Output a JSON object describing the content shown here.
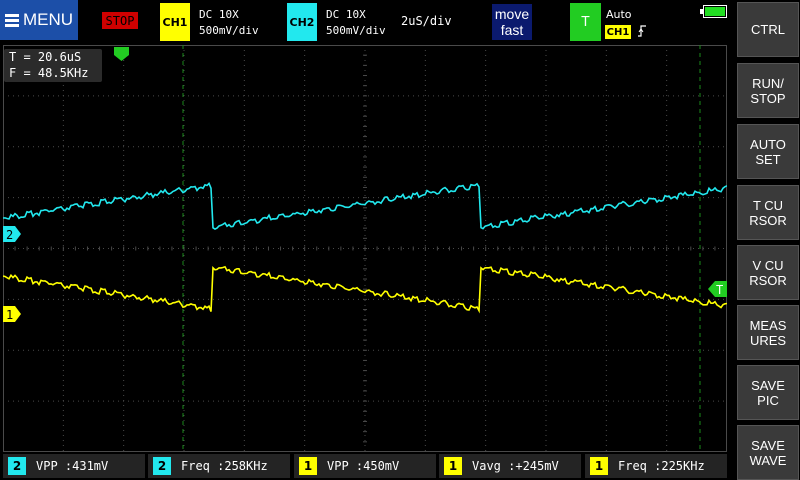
{
  "topbar": {
    "menu_label": "MENU",
    "run_state": "STOP",
    "ch1": {
      "tag": "CH1",
      "coupling": "DC  10X",
      "scale": "500mV/div"
    },
    "ch2": {
      "tag": "CH2",
      "coupling": "DC  10X",
      "scale": "500mV/div"
    },
    "timebase": "2uS/div",
    "move_line1": "move",
    "move_line2": "fast",
    "trigger": {
      "tag": "T",
      "mode": "Auto",
      "source": "CH1",
      "edge_icon": "rising-edge-icon"
    },
    "battery_level": 1.0
  },
  "cursor_readout": {
    "period": "T = 20.6uS",
    "frequency": "F = 48.5KHz"
  },
  "markers": {
    "ch1": "1",
    "ch2": "2",
    "trigger": "T"
  },
  "side_buttons": [
    {
      "label": "CTRL"
    },
    {
      "label": "RUN/\nSTOP"
    },
    {
      "label": "AUTO\nSET"
    },
    {
      "label": "T CU\nRSOR"
    },
    {
      "label": "V CU\nRSOR"
    },
    {
      "label": "MEAS\nURES"
    },
    {
      "label": "SAVE\nPIC"
    },
    {
      "label": "SAVE\nWAVE"
    }
  ],
  "measurements": [
    {
      "channel": "2",
      "text": "VPP :431mV"
    },
    {
      "channel": "2",
      "text": "Freq :258KHz"
    },
    {
      "channel": "1",
      "text": "VPP :450mV"
    },
    {
      "channel": "1",
      "text": "Vavg :+245mV"
    },
    {
      "channel": "1",
      "text": "Freq :225KHz"
    }
  ],
  "colors": {
    "ch1": "#ffff00",
    "ch2": "#22e8ee",
    "grid": "#4a4a4a",
    "cursor": "#1a8a1a",
    "menu": "#1c4fa8",
    "stop": "#d00000",
    "trigger": "#22cc22"
  }
}
